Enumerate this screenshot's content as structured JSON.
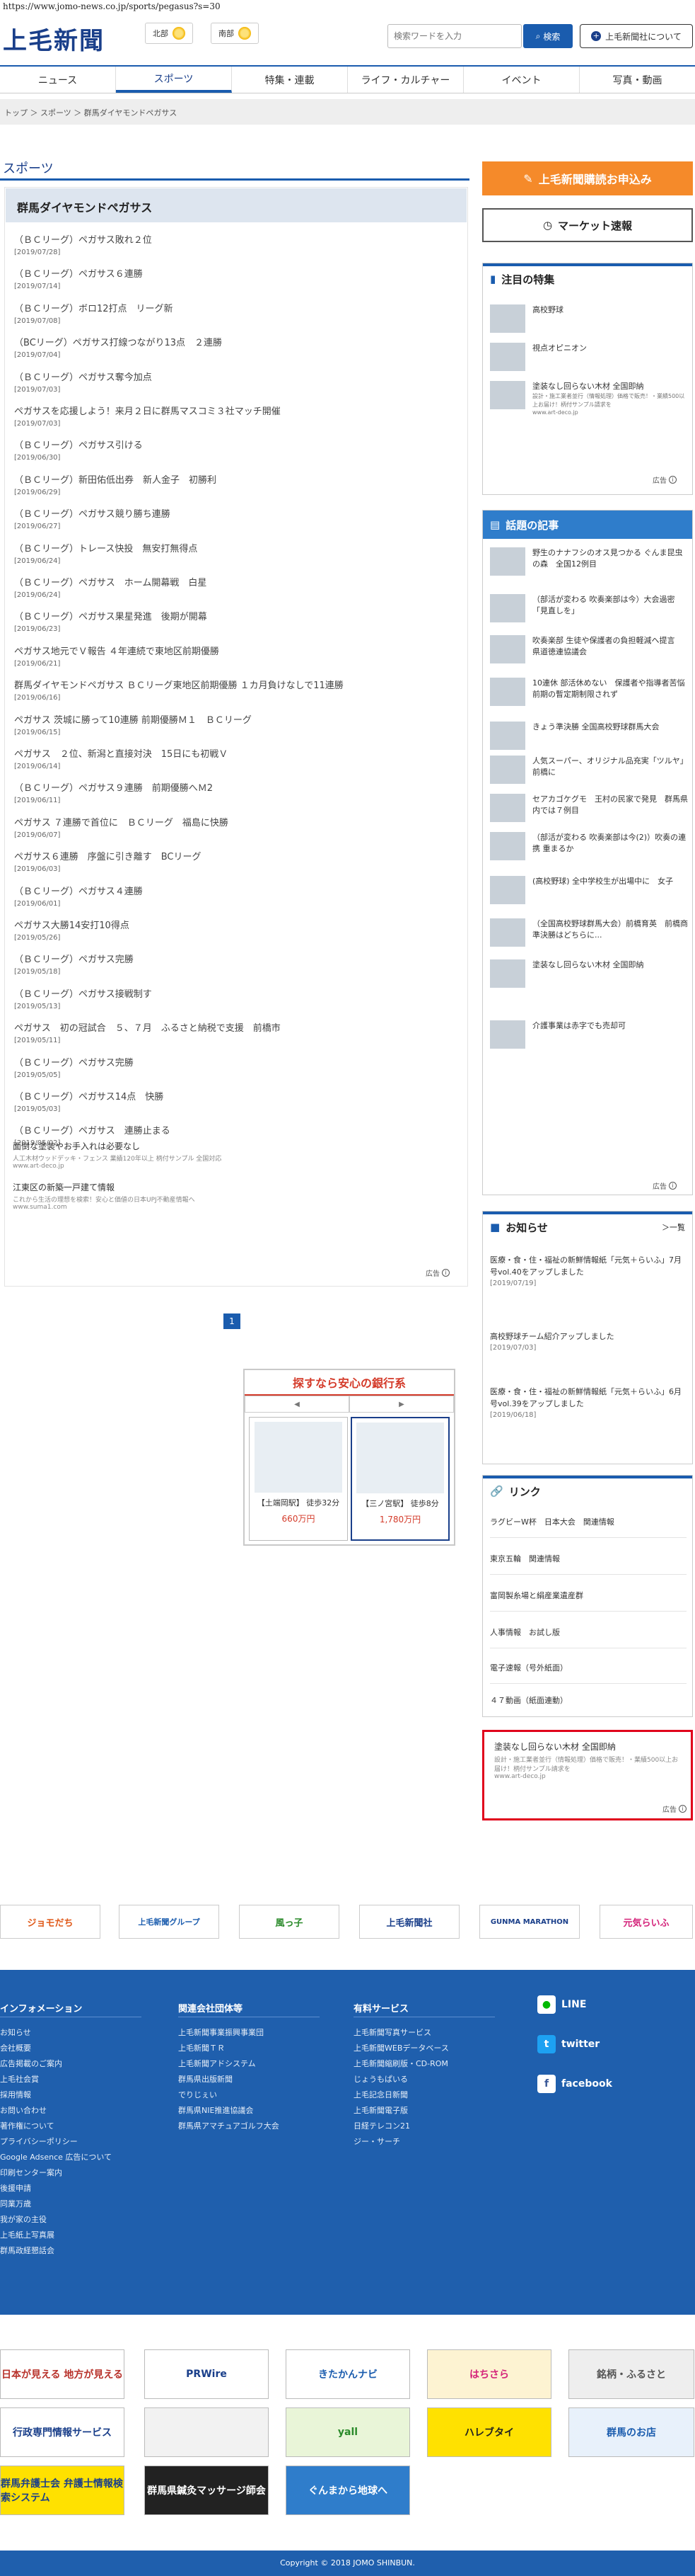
{
  "url": "https://www.jomo-news.co.jp/sports/pegasus?s=30",
  "header": {
    "logo": "上毛新聞",
    "weather": [
      {
        "area": "北部"
      },
      {
        "area": "南部"
      }
    ],
    "search_placeholder": "検索ワードを入力",
    "search_label": "検索",
    "about_label": "上毛新聞社について"
  },
  "nav": [
    "ニュース",
    "スポーツ",
    "特集・連載",
    "ライフ・カルチャー",
    "イベント",
    "写真・動画"
  ],
  "breadcrumb": "トップ ＞ スポーツ ＞ 群馬ダイヤモンドペガサス",
  "main": {
    "section_title": "スポーツ",
    "list_title": "群馬ダイヤモンドペガサス",
    "articles": [
      {
        "title": "（ＢＣリーグ）ペガサス敗れ２位",
        "date": "[2019/07/28]"
      },
      {
        "title": "（ＢＣリーグ）ペガサス６連勝",
        "date": "[2019/07/14]"
      },
      {
        "title": "（ＢＣリーグ）ボロ12打点　リーグ新",
        "date": "[2019/07/08]"
      },
      {
        "title": "（BCリーグ）ペガサス打線つながり13点　２連勝",
        "date": "[2019/07/04]"
      },
      {
        "title": "（ＢＣリーグ）ペガサス奪今加点",
        "date": "[2019/07/03]"
      },
      {
        "title": "ペガサスを応援しよう！来月２日に群馬マスコミ３社マッチ開催",
        "date": "[2019/07/03]"
      },
      {
        "title": "（ＢＣリーグ）ペガサス引ける",
        "date": "[2019/06/30]"
      },
      {
        "title": "（ＢＣリーグ）新田佑低出券　新人金子　初勝利",
        "date": "[2019/06/29]"
      },
      {
        "title": "（ＢＣリーグ）ペガサス競り勝ち連勝",
        "date": "[2019/06/27]"
      },
      {
        "title": "（ＢＣリーグ）トレース快投　無安打無得点",
        "date": "[2019/06/24]"
      },
      {
        "title": "（ＢＣリーグ）ペガサス　ホーム開幕戦　白星",
        "date": "[2019/06/24]"
      },
      {
        "title": "（ＢＣリーグ）ペガサス果星発進　後期が開幕",
        "date": "[2019/06/23]"
      },
      {
        "title": "ペガサス地元でＶ報告 ４年連続で東地区前期優勝",
        "date": "[2019/06/21]"
      },
      {
        "title": "群馬ダイヤモンドペガサス ＢＣリーグ東地区前期優勝 １カ月負けなしで11連勝",
        "date": "[2019/06/16]"
      },
      {
        "title": "ペガサス 茨城に勝って10連勝 前期優勝Ｍ１　ＢＣリーグ",
        "date": "[2019/06/15]"
      },
      {
        "title": "ペガサス　２位、新潟と直接対決　15日にも初戦Ｖ",
        "date": "[2019/06/14]"
      },
      {
        "title": "（ＢＣリーグ）ペガサス９連勝　前期優勝へＭ2",
        "date": "[2019/06/11]"
      },
      {
        "title": "ペガサス ７連勝で首位に　ＢＣリーグ　福島に快勝",
        "date": "[2019/06/07]"
      },
      {
        "title": "ペガサス６連勝　序盤に引き離す　BCリーグ",
        "date": "[2019/06/03]"
      },
      {
        "title": "（ＢＣリーグ）ペガサス４連勝",
        "date": "[2019/06/01]"
      },
      {
        "title": "ペガサス大勝14安打10得点",
        "date": "[2019/05/26]"
      },
      {
        "title": "（ＢＣリーグ）ペガサス完勝",
        "date": "[2019/05/18]"
      },
      {
        "title": "（ＢＣリーグ）ペガサス接戦制す",
        "date": "[2019/05/13]"
      },
      {
        "title": "ペガサス　初の冠試合　５、７月　ふるさと納税で支援　前橋市",
        "date": "[2019/05/11]"
      },
      {
        "title": "（ＢＣリーグ）ペガサス完勝",
        "date": "[2019/05/05]"
      },
      {
        "title": "（ＢＣリーグ）ペガサス14点　快勝",
        "date": "[2019/05/03]"
      },
      {
        "title": "（ＢＣリーグ）ペガサス　連勝止まる",
        "date": "[2019/05/02]"
      }
    ],
    "ads": [
      {
        "title": "面倒な塗装やお手入れは必要なし",
        "sub": "人工木材ウッドデッキ・フェンス 業績120年以上 柄付サンプル 全国対応",
        "url": "www.art-deco.jp"
      },
      {
        "title": "江東区の新築一戸建て情報",
        "sub": "これから生活の理想を検索！安心と価値の日本UPJ不動産情報へ",
        "url": "www.suma1.com"
      }
    ],
    "ad_label": "広告",
    "page": "1"
  },
  "bank_ad": {
    "title": "探すなら安心の銀行系",
    "cards": [
      {
        "label": "【土端岡駅】 徒歩32分",
        "price": "660万円"
      },
      {
        "label": "【三ノ宮駅】 徒歩8分",
        "price": "1,780万円"
      }
    ]
  },
  "sidebar": {
    "subscribe": "上毛新聞購読お申込み",
    "market": "マーケット速報",
    "featured_title": "注目の特集",
    "featured": [
      {
        "text": "高校野球"
      },
      {
        "text": "視点オピニオン"
      },
      {
        "text": "塗装なし回らない木材 全国即納",
        "small": "設計・施工業者並行（情報処理）価格で販売！・業績500以上お届け！柄付サンプル請求を",
        "url": "www.art-deco.jp"
      }
    ],
    "popular_title": "話題の記事",
    "popular": [
      "野生のナナフシのオス見つかる ぐんま昆虫の森　全国12例目",
      "（部活が変わる 吹奏楽部は今）大会過密「見直しを」",
      "吹奏楽部 生徒や保護者の負担軽減へ提言　県道徳連協議会",
      "10連休 部活休めない　保護者や指導者苦悩　前期の暫定期制限されず",
      "きょう準決勝 全国高校野球群馬大会",
      "人気スーパー、オリジナル品充実「ツルヤ」前橋に",
      "セアカゴケグモ　王村の民家で発見　群馬県内では７例目",
      "（部活が変わる 吹奏楽部は今(2)）吹奏の連携 重まるか",
      "(高校野球) 全中学校生が出場中に　女子",
      "（全国高校野球群馬大会）前橋育英　前橋商　準決勝はどちらに...",
      "塗装なし回らない木材 全国即納",
      "介護事業は赤字でも売却可"
    ],
    "notice_title": "お知らせ",
    "notice_more": "＞一覧",
    "notices": [
      {
        "text": "医療・食・住・福祉の新鮮情報紙「元気＋らいふ」7月号vol.40をアップしました",
        "date": "[2019/07/19]"
      },
      {
        "text": "高校野球チーム紹介アップしました",
        "date": "[2019/07/03]"
      },
      {
        "text": "医療・食・住・福祉の新鮮情報紙「元気＋らいふ」6月号vol.39をアップしました",
        "date": "[2019/06/18]"
      }
    ],
    "links_title": "リンク",
    "links": [
      "ラグビーW杯　日本大会　関連情報",
      "東京五輪　関連情報",
      "富岡製糸場と絹産業遺産群",
      "人事情報　お試し版",
      "電子速報（号外紙面）",
      "４７動画（紙面連動）"
    ],
    "red_ad": {
      "title": "塗装なし回らない木材 全国即納",
      "sub": "設計・施工業者並行（情報処理）価格で販売！・業績500以上お届け！柄付サンプル請求を",
      "url": "www.art-deco.jp"
    }
  },
  "banners_row1": [
    "ジョモだち",
    "上毛新聞グループ",
    "風っ子",
    "上毛新聞社",
    "GUNMA MARATHON",
    "元気らいふ"
  ],
  "footer": {
    "col1_title": "インフォメーション",
    "col1": [
      "お知らせ",
      "会社概要",
      "広告掲載のご案内",
      "上毛社会賞",
      "採用情報",
      "お問い合わせ",
      "著作権について",
      "プライバシーポリシー",
      "Google Adsence 広告について",
      "印刷センター案内",
      "後援申請",
      "同業万歳",
      "我が家の主役",
      "上毛紙上写真展",
      "群馬政経懇話会"
    ],
    "col2_title": "関連会社団体等",
    "col2": [
      "上毛新聞事業振興事業団",
      "上毛新聞ＴＲ",
      "上毛新聞アドシステム",
      "群馬県出版新聞",
      "でりじぇい",
      "群馬県NIE推進協議会",
      "群馬県アマチュアゴルフ大会"
    ],
    "col3_title": "有料サービス",
    "col3": [
      "上毛新聞写真サービス",
      "上毛新聞WEBデータベース",
      "上毛新聞縮刷版・CD-ROM",
      "じょうもぱいる",
      "上毛記念日新聞",
      "上毛新聞電子版",
      "日経テレコン21",
      "ジー・サーチ"
    ],
    "social": [
      "LINE",
      "twitter",
      "facebook"
    ]
  },
  "bottom_banners": [
    "日本が見える 地方が見える",
    "PRWire",
    "きたかんナビ",
    "はちさら",
    "銘柄・ふるさと",
    "行政専門情報サービス",
    "",
    "yall",
    "ハレブタイ",
    "群馬のお店",
    "群馬弁護士会 弁護士情報検索システム",
    "群馬県鍼灸マッサージ師会",
    "ぐんまから地球へ"
  ],
  "copyright": "Copyright © 2018 JOMO SHINBUN."
}
